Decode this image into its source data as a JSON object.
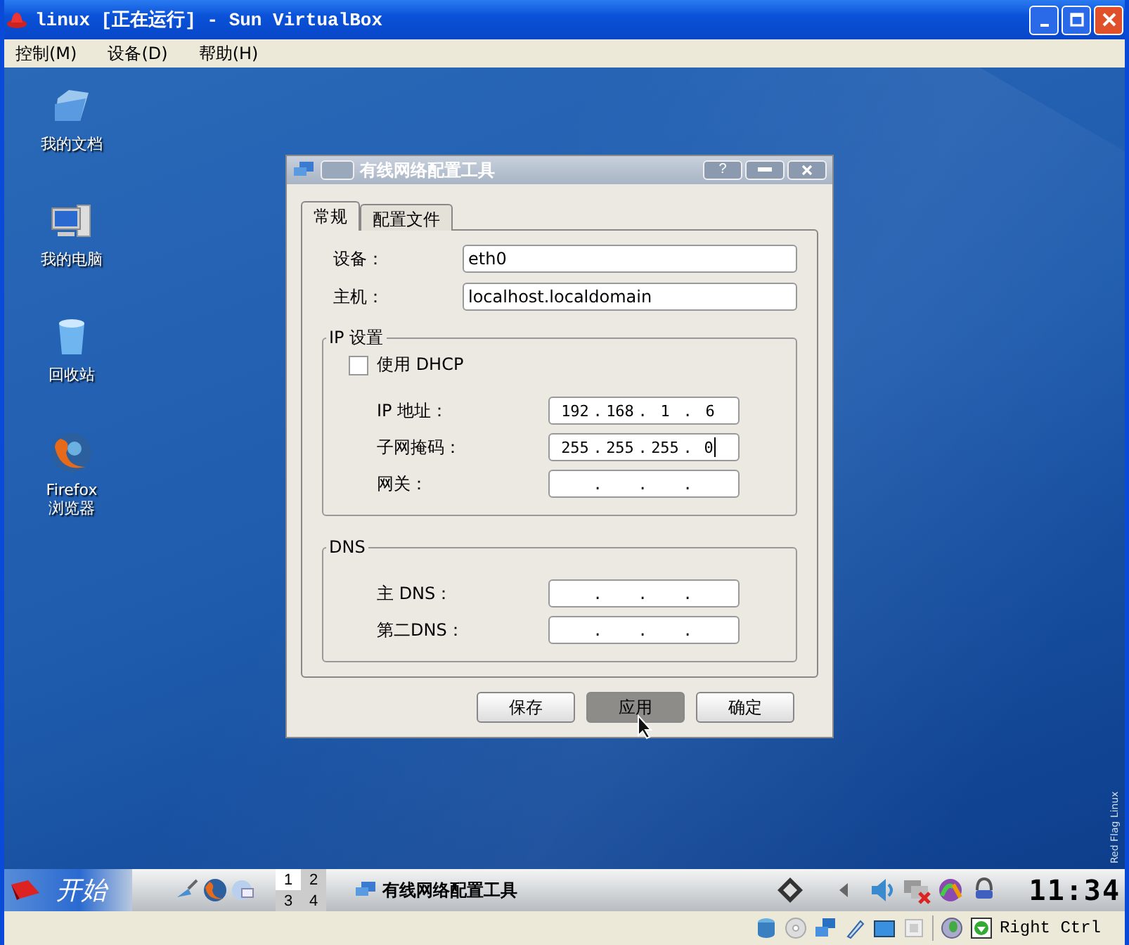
{
  "window": {
    "title": "linux [正在运行] - Sun VirtualBox"
  },
  "menu": [
    "控制(M)",
    "设备(D)",
    "帮助(H)"
  ],
  "desktop_icons": [
    {
      "kind": "folder",
      "label": "我的文档"
    },
    {
      "kind": "computer",
      "label": "我的电脑"
    },
    {
      "kind": "trash",
      "label": "回收站"
    },
    {
      "kind": "browser",
      "label": "Firefox 浏览器"
    }
  ],
  "wallpaper_text": "Red Flag Linux",
  "dialog": {
    "title": "有线网络配置工具",
    "title_buttons": [
      "?"
    ],
    "tabs": [
      {
        "label": "常规",
        "selected": true
      },
      {
        "label": "配置文件",
        "selected": false
      }
    ],
    "fields": [
      {
        "label": "设备：",
        "value": "eth0"
      },
      {
        "label": "主机：",
        "value": "localhost.localdomain"
      }
    ],
    "ip_separator": ".",
    "ip_group": {
      "title": "IP 设置",
      "dhcp": {
        "label": "使用 DHCP",
        "checked": false
      },
      "fields": [
        {
          "label": "IP 地址：",
          "octets": [
            "192",
            "168",
            "1",
            "6"
          ],
          "caret": false
        },
        {
          "label": "子网掩码：",
          "octets": [
            "255",
            "255",
            "255",
            "0"
          ],
          "caret": true
        },
        {
          "label": "网关：",
          "caret": false
        }
      ]
    },
    "dns_group": {
      "title": "DNS",
      "fields": [
        {
          "label": "主 DNS：",
          "caret": false
        },
        {
          "label": "第二DNS：",
          "caret": false
        }
      ]
    },
    "buttons": [
      {
        "label": "保存",
        "pressed": false
      },
      {
        "label": "应用",
        "pressed": true
      },
      {
        "label": "确定",
        "pressed": false
      }
    ]
  },
  "taskbar": {
    "start": "开始",
    "pager": [
      {
        "label": "1",
        "selected": true
      },
      {
        "label": "2",
        "selected": false
      },
      {
        "label": "3",
        "selected": false
      },
      {
        "label": "4",
        "selected": false
      }
    ],
    "task": "有线网络配置工具",
    "clock": "11:34"
  },
  "status_bar": {
    "host_key": "Right Ctrl"
  }
}
